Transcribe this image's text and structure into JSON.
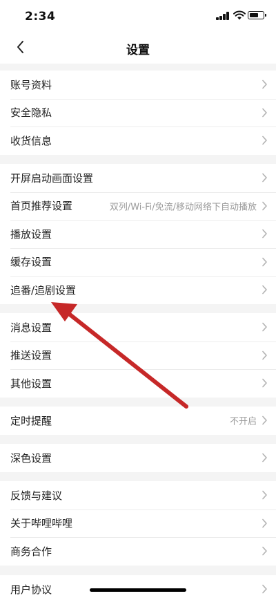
{
  "status": {
    "time": "2:34"
  },
  "header": {
    "title": "设置"
  },
  "groups": [
    {
      "rows": [
        {
          "label": "账号资料"
        },
        {
          "label": "安全隐私"
        },
        {
          "label": "收货信息"
        }
      ]
    },
    {
      "rows": [
        {
          "label": "开屏启动画面设置"
        },
        {
          "label": "首页推荐设置",
          "value": "双列/Wi-Fi/免流/移动网络下自动播放"
        },
        {
          "label": "播放设置"
        },
        {
          "label": "缓存设置"
        },
        {
          "label": "追番/追剧设置"
        }
      ]
    },
    {
      "rows": [
        {
          "label": "消息设置"
        },
        {
          "label": "推送设置"
        },
        {
          "label": "其他设置"
        }
      ]
    },
    {
      "rows": [
        {
          "label": "定时提醒",
          "value": "不开启"
        }
      ]
    },
    {
      "rows": [
        {
          "label": "深色设置"
        }
      ]
    },
    {
      "rows": [
        {
          "label": "反馈与建议"
        },
        {
          "label": "关于哔哩哔哩"
        },
        {
          "label": "商务合作"
        }
      ]
    },
    {
      "rows": [
        {
          "label": "用户协议"
        }
      ]
    }
  ],
  "icons": {
    "back": "chevron-left-icon",
    "row": "chevron-right-icon"
  },
  "colors": {
    "annotation_arrow": "#c62828"
  },
  "battery": {
    "level": 0.7
  }
}
